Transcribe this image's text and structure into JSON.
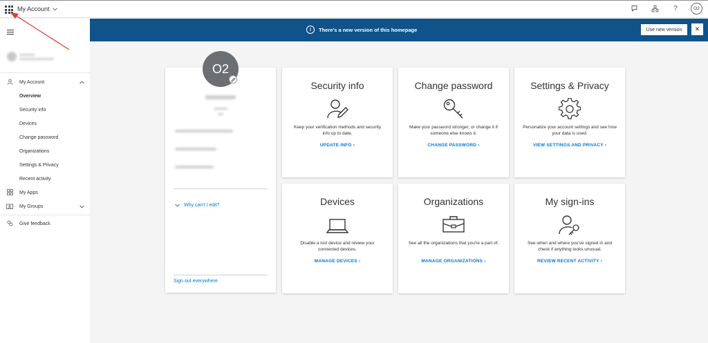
{
  "header": {
    "app_title": "My Account",
    "avatar_initials": "O2",
    "help_glyph": "?"
  },
  "sidebar": {
    "items": [
      {
        "label": "My Account",
        "icon": "person-icon"
      },
      {
        "label": "My Apps",
        "icon": "apps-icon"
      },
      {
        "label": "My Groups",
        "icon": "groups-icon"
      },
      {
        "label": "Give feedback",
        "icon": "feedback-icon"
      }
    ],
    "sub_items": [
      "Overview",
      "Security info",
      "Devices",
      "Change password",
      "Organizations",
      "Settings & Privacy",
      "Recent activity"
    ],
    "active_sub_item": "Overview"
  },
  "banner": {
    "message": "There's a new version of this homepage",
    "use_new_label": "Use new version",
    "close_glyph": "✕",
    "background": "#0f538a"
  },
  "profile_card": {
    "avatar_initials": "O2",
    "why_cant_edit": "Why can't I edit?",
    "sign_out": "Sign out everywhere"
  },
  "tiles": [
    {
      "title": "Security info",
      "desc": "Keep your verification methods and security info up to date.",
      "link": "UPDATE INFO",
      "icon": "user-edit-icon"
    },
    {
      "title": "Change password",
      "desc": "Make your password stronger, or change it if someone else knows it.",
      "link": "CHANGE PASSWORD",
      "icon": "key-icon"
    },
    {
      "title": "Settings & Privacy",
      "desc": "Personalize your account settings and see how your data is used.",
      "link": "VIEW SETTINGS AND PRIVACY",
      "icon": "gear-icon"
    },
    {
      "title": "Devices",
      "desc": "Disable a lost device and review your connected devices.",
      "link": "MANAGE DEVICES",
      "icon": "laptop-icon"
    },
    {
      "title": "Organizations",
      "desc": "See all the organizations that you're a part of.",
      "link": "MANAGE ORGANIZATIONS",
      "icon": "briefcase-icon"
    },
    {
      "title": "My sign-ins",
      "desc": "See when and where you've signed in and check if anything looks unusual.",
      "link": "REVIEW RECENT ACTIVITY",
      "icon": "user-key-icon"
    }
  ],
  "colors": {
    "accent": "#0078d4",
    "annotation_arrow": "#e0392b"
  }
}
